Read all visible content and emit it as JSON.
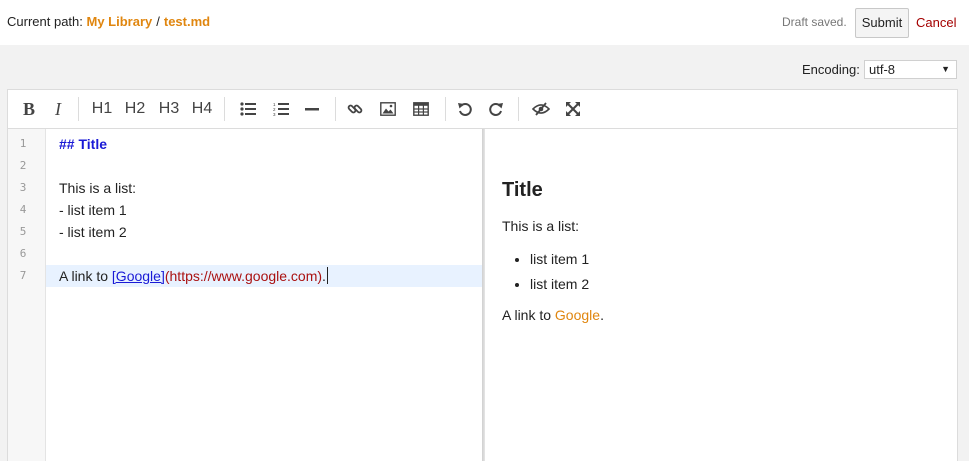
{
  "header": {
    "path_label": "Current path:",
    "breadcrumbs": [
      "My Library",
      "test.md"
    ],
    "separator": "/",
    "status": "Draft saved.",
    "submit_label": "Submit",
    "cancel_label": "Cancel"
  },
  "encoding": {
    "label": "Encoding:",
    "selected": "utf-8"
  },
  "toolbar": {
    "bold": "B",
    "italic": "I",
    "h1": "H1",
    "h2": "H2",
    "h3": "H3",
    "h4": "H4",
    "icons": [
      "bulleted-list-icon",
      "numbered-list-icon",
      "horizontal-rule-icon",
      "link-icon",
      "image-icon",
      "table-icon",
      "undo-icon",
      "redo-icon",
      "preview-toggle-icon",
      "fullscreen-icon"
    ]
  },
  "editor": {
    "line_numbers": [
      "1",
      "2",
      "3",
      "4",
      "5",
      "6",
      "7"
    ],
    "lines": {
      "l1": "## Title",
      "l3": "This is a list:",
      "l4": "- list item 1",
      "l5": "- list item 2",
      "l7_prefix": "A link to ",
      "l7_link_text": "[Google]",
      "l7_link_url": "(https://www.google.com)",
      "l7_suffix": "."
    }
  },
  "preview": {
    "title": "Title",
    "intro": "This is a list:",
    "items": [
      "list item 1",
      "list item 2"
    ],
    "link_prefix": "A link to ",
    "link_text": "Google",
    "link_suffix": "."
  },
  "colors": {
    "accent": "#e0860f",
    "cancel": "#a40000",
    "heading": "#1a1ad6",
    "url": "#aa1111"
  }
}
